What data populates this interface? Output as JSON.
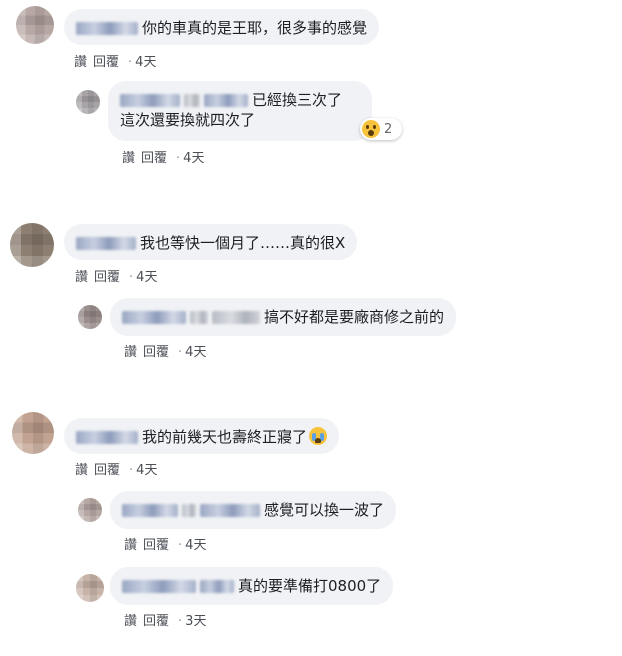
{
  "labels": {
    "like": "讚",
    "reply": "回覆",
    "dot": "·"
  },
  "colors": {
    "bubble": "#f0f2f5",
    "action_text": "#4b4f56"
  },
  "comments": [
    {
      "text": "你的車真的是王耶，很多事的感覺",
      "time": "4天"
    },
    {
      "text_line1": "已經換三次了",
      "text_line2": "這次還要換就四次了",
      "time": "4天",
      "reaction": {
        "icon": "wow-emoji-icon",
        "count": "2"
      }
    },
    {
      "text": "我也等快一個月了……真的很X",
      "time": "4天"
    },
    {
      "text": "搞不好都是要廠商修之前的",
      "time": "4天"
    },
    {
      "text": "我的前幾天也壽終正寢了",
      "emoji": "crying-emoji-icon",
      "time": "4天"
    },
    {
      "text": "感覺可以換一波了",
      "time": "4天"
    },
    {
      "text": "真的要準備打0800了",
      "time": "3天"
    }
  ]
}
